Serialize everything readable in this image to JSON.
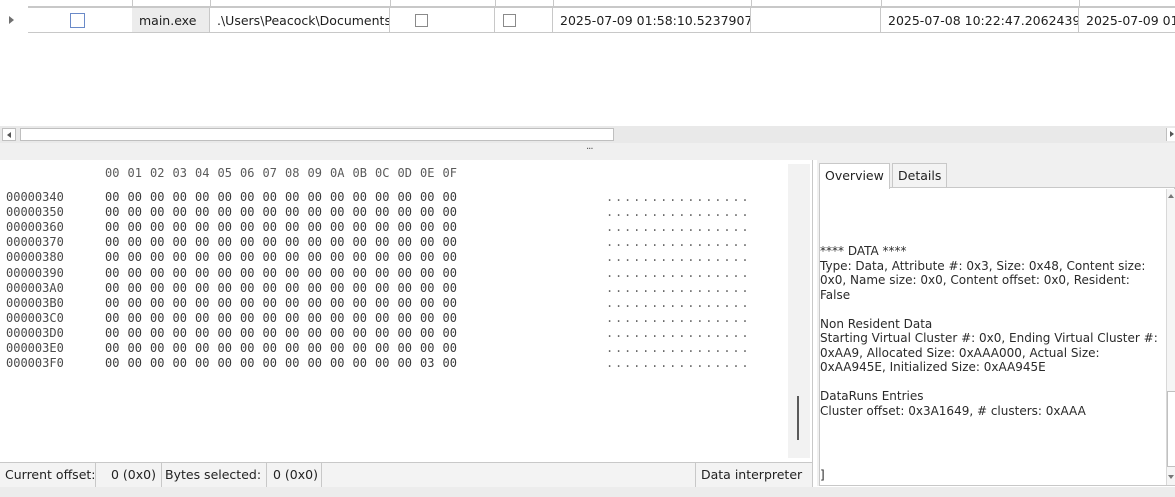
{
  "table": {
    "row": {
      "name": "main.exe",
      "path": ".\\Users\\Peacock\\Documents",
      "created": "2025-07-09 01:58:10.5237907",
      "modified": "2025-07-08 10:22:47.2062439",
      "accessed": "2025-07-09 01:"
    }
  },
  "hex": {
    "header": [
      "00",
      "01",
      "02",
      "03",
      "04",
      "05",
      "06",
      "07",
      "08",
      "09",
      "0A",
      "0B",
      "0C",
      "0D",
      "0E",
      "0F"
    ],
    "rows": [
      {
        "offset": "00000340",
        "bytes": "00 00 00 00 00 00 00 00 00 00 00 00 00 00 00 00",
        "ascii": "................"
      },
      {
        "offset": "00000350",
        "bytes": "00 00 00 00 00 00 00 00 00 00 00 00 00 00 00 00",
        "ascii": "................"
      },
      {
        "offset": "00000360",
        "bytes": "00 00 00 00 00 00 00 00 00 00 00 00 00 00 00 00",
        "ascii": "................"
      },
      {
        "offset": "00000370",
        "bytes": "00 00 00 00 00 00 00 00 00 00 00 00 00 00 00 00",
        "ascii": "................"
      },
      {
        "offset": "00000380",
        "bytes": "00 00 00 00 00 00 00 00 00 00 00 00 00 00 00 00",
        "ascii": "................"
      },
      {
        "offset": "00000390",
        "bytes": "00 00 00 00 00 00 00 00 00 00 00 00 00 00 00 00",
        "ascii": "................"
      },
      {
        "offset": "000003A0",
        "bytes": "00 00 00 00 00 00 00 00 00 00 00 00 00 00 00 00",
        "ascii": "................"
      },
      {
        "offset": "000003B0",
        "bytes": "00 00 00 00 00 00 00 00 00 00 00 00 00 00 00 00",
        "ascii": "................"
      },
      {
        "offset": "000003C0",
        "bytes": "00 00 00 00 00 00 00 00 00 00 00 00 00 00 00 00",
        "ascii": "................"
      },
      {
        "offset": "000003D0",
        "bytes": "00 00 00 00 00 00 00 00 00 00 00 00 00 00 00 00",
        "ascii": "................"
      },
      {
        "offset": "000003E0",
        "bytes": "00 00 00 00 00 00 00 00 00 00 00 00 00 00 00 00",
        "ascii": "................"
      },
      {
        "offset": "000003F0",
        "bytes": "00 00 00 00 00 00 00 00 00 00 00 00 00 00 03 00",
        "ascii": "................"
      }
    ]
  },
  "status": {
    "current_offset_label": "Current offset:",
    "current_offset_value": "0 (0x0)",
    "bytes_selected_label": "Bytes selected:",
    "bytes_selected_value": "0 (0x0)",
    "data_interpreter": "Data interpreter"
  },
  "panel": {
    "tabs": [
      "Overview",
      "Details"
    ],
    "text": [
      "**** DATA ****",
      "Type: Data, Attribute #: 0x3, Size: 0x48, Content size: 0x0, Name size: 0x0, Content offset: 0x0, Resident: False",
      "Non Resident Data",
      "Starting Virtual Cluster #: 0x0, Ending Virtual Cluster #: 0xAA9, Allocated Size: 0xAAA000, Actual Size: 0xAA945E, Initialized Size: 0xAA945E",
      "DataRuns Entries",
      "Cluster offset: 0x3A1649, # clusters: 0xAAA"
    ],
    "bracket": "]"
  },
  "splitter_grip": "···"
}
